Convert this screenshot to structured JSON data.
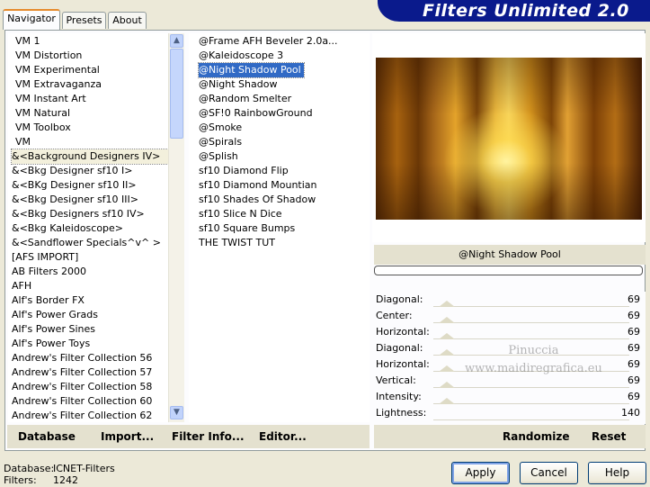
{
  "tabs": [
    {
      "label": "Navigator"
    },
    {
      "label": "Presets"
    },
    {
      "label": "About"
    }
  ],
  "app_title": "Filters Unlimited 2.0",
  "categories": [
    "VM 1",
    "VM Distortion",
    "VM Experimental",
    "VM Extravaganza",
    "VM Instant Art",
    "VM Natural",
    "VM Toolbox",
    "VM",
    "&<Background Designers IV>",
    "&<Bkg Designer sf10 I>",
    "&<BKg Designer sf10 II>",
    "&<Bkg Designer sf10 III>",
    "&<Bkg Designers sf10 IV>",
    "&<Bkg Kaleidoscope>",
    "&<Sandflower Specials^v^ >",
    "[AFS IMPORT]",
    "AB Filters 2000",
    "AFH",
    "Alf's Border FX",
    "Alf's Power Grads",
    "Alf's Power Sines",
    "Alf's Power Toys",
    "Andrew's Filter Collection 56",
    "Andrew's Filter Collection 57",
    "Andrew's Filter Collection 58",
    "Andrew's Filter Collection 60",
    "Andrew's Filter Collection 62"
  ],
  "filters": [
    "@Frame AFH Beveler 2.0a...",
    "@Kaleidoscope 3",
    "@Night Shadow Pool",
    "@Night Shadow",
    "@Random Smelter",
    "@SF!0 RainbowGround",
    "@Smoke",
    "@Spirals",
    "@Splish",
    "sf10 Diamond Flip",
    "sf10 Diamond Mountian",
    "sf10 Shades Of Shadow",
    "sf10 Slice N Dice",
    "sf10 Square Bumps",
    "THE TWIST TUT"
  ],
  "selected_filter": "@Night Shadow Pool",
  "params": [
    {
      "label": "Diagonal:",
      "value": "69"
    },
    {
      "label": "Center:",
      "value": "69"
    },
    {
      "label": "Horizontal:",
      "value": "69"
    },
    {
      "label": "Diagonal:",
      "value": "69"
    },
    {
      "label": "Horizontal:",
      "value": "69"
    },
    {
      "label": "Vertical:",
      "value": "69"
    },
    {
      "label": "Intensity:",
      "value": "69"
    },
    {
      "label": "Lightness:",
      "value": "140"
    }
  ],
  "watermark": {
    "line1": "Pinuccia",
    "line2": "www.maidiregrafica.eu"
  },
  "toolbar": {
    "database": "Database",
    "import": "Import...",
    "filter_info": "Filter Info...",
    "editor": "Editor...",
    "randomize": "Randomize",
    "reset": "Reset"
  },
  "status": {
    "database_label": "Database:",
    "database_value": "ICNET-Filters",
    "filters_label": "Filters:",
    "filters_value": "1242"
  },
  "buttons": {
    "apply": "Apply",
    "cancel": "Cancel",
    "help": "Help"
  },
  "icons": {
    "scroll_up": "arrow-up-icon",
    "scroll_down": "arrow-down-icon"
  }
}
